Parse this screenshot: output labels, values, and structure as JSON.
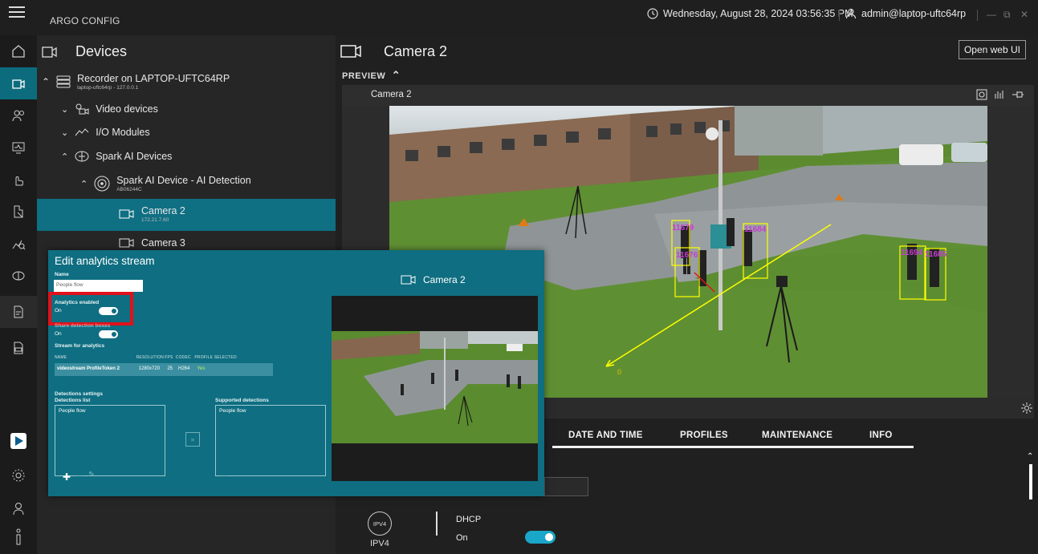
{
  "titlebar": {
    "app_title": "ARGO CONFIG",
    "datetime": "Wednesday, August 28, 2024 03:56:35 PM",
    "user": "admin@laptop-uftc64rp",
    "minimize": "—",
    "maximize": "⧉",
    "close": "✕"
  },
  "rail": {
    "items": [
      "home-icon",
      "devices-icon",
      "users-icon",
      "monitor-icon",
      "hand-icon",
      "pointer-icon",
      "analytics-icon",
      "spark-icon",
      "report-icon",
      "log-icon"
    ],
    "bottom": [
      "brand-icon",
      "settings-icon",
      "account-icon",
      "info-icon",
      "menu-icon"
    ]
  },
  "tree": {
    "title": "Devices",
    "recorder_name": "Recorder on LAPTOP-UFTC64RP",
    "recorder_sub": "laptop-uftc64rp - 127.0.0.1",
    "video_devices": "Video devices",
    "io_modules": "I/O Modules",
    "spark_devices": "Spark AI Devices",
    "spark_device": "Spark AI Device - AI Detection",
    "spark_device_sub": "AB06244C",
    "camera2": "Camera 2",
    "camera2_ip": "172.21.7.60",
    "camera3": "Camera 3"
  },
  "main": {
    "camera_title": "Camera 2",
    "open_web_ui": "Open web UI",
    "preview_label": "PREVIEW",
    "preview_camera": "Camera 2",
    "tabs": [
      "DATE AND TIME",
      "PROFILES",
      "MAINTENANCE",
      "INFO"
    ],
    "ipv4_badge": "IPV4",
    "ipv4_label": "IPV4",
    "dhcp_label": "DHCP",
    "dhcp_value": "On",
    "detections": [
      "11679",
      "11684",
      "11676",
      "11694",
      "11685"
    ],
    "counter_value": "0"
  },
  "dialog": {
    "title": "Edit analytics stream",
    "name_label": "Name",
    "name_value": "People flow",
    "analytics_enabled_label": "Analytics enabled",
    "analytics_enabled_value": "On",
    "second_toggle_label": "Share detection boxes",
    "second_toggle_value": "On",
    "stream_label": "Stream for analytics",
    "table_headers": [
      "NAME",
      "RESOLUTION",
      "FPS",
      "CODEC",
      "PROFILE SELECTED"
    ],
    "table_row": [
      "videostream ProfileToken 2",
      "1280x720",
      "25",
      "H264",
      "Yes"
    ],
    "detections_settings": "Detections settings",
    "detections_list_label": "Detections list",
    "supported_label": "Supported detections",
    "detections_list_item": "People flow",
    "supported_item": "People flow",
    "right_camera": "Camera 2"
  },
  "colors": {
    "accent": "#0f6e81",
    "highlight_red": "#e2101a",
    "toggle": "#1aa6c8"
  }
}
